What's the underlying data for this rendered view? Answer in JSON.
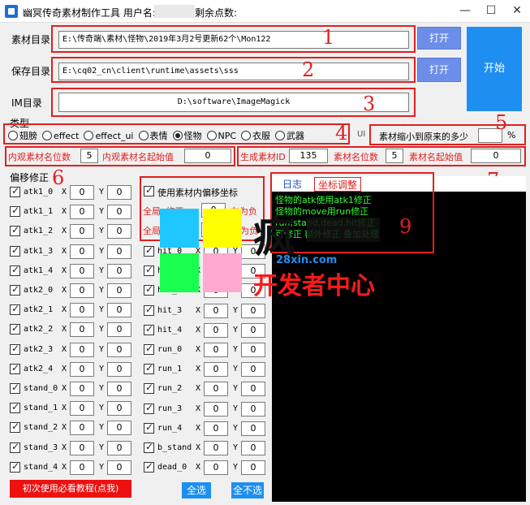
{
  "window": {
    "title": "幽冥传奇素材制作工具 用户名:",
    "title_remain": "剩余点数:",
    "minimize": "—",
    "maximize": "☐",
    "close": "✕"
  },
  "paths": {
    "material_label": "素材目录",
    "material_value": "E:\\传奇端\\素材\\怪物\\2019年3月2号更新62个\\Mon122",
    "save_label": "保存目录",
    "save_value": "E:\\cq02_cn\\client\\runtime\\assets\\sss",
    "im_label": "IM目录",
    "im_value": "D:\\software\\ImageMagick",
    "open_label": "打开",
    "open2_label": "打开",
    "start_label": "开始"
  },
  "type": {
    "label": "类型",
    "options": [
      "翅膀",
      "effect",
      "effect_ui",
      "表情",
      "怪物",
      "NPC",
      "衣服",
      "武器"
    ],
    "selected": 4
  },
  "scale": {
    "label": "素材缩小到原来的多少",
    "value": "",
    "unit": "%",
    "ui_tag": "UI"
  },
  "inner": {
    "digits_label": "内观素材名位数",
    "digits_value": "5",
    "start_label": "内观素材名起始值",
    "start_value": "0"
  },
  "gen": {
    "id_label": "生成素材ID",
    "id_value": "135",
    "digits_label": "素材名位数",
    "digits_value": "5",
    "start_label": "素材名起始值",
    "start_value": "0"
  },
  "offset": {
    "label": "偏移修正",
    "use_internal_label": "使用素材内偏移坐标",
    "x_label": "X",
    "y_label": "Y",
    "global_x_label": "全局x修正",
    "global_y_label": "全局",
    "global_x_value": "0",
    "global_y_value": "0",
    "hint_pos": "左为负",
    "hint_pos2": "为负",
    "left_rows": [
      {
        "name": "atk1_0",
        "x": "0",
        "y": "0"
      },
      {
        "name": "atk1_1",
        "x": "0",
        "y": "0"
      },
      {
        "name": "atk1_2",
        "x": "0",
        "y": "0"
      },
      {
        "name": "atk1_3",
        "x": "0",
        "y": "0"
      },
      {
        "name": "atk1_4",
        "x": "0",
        "y": "0"
      },
      {
        "name": "atk2_0",
        "x": "0",
        "y": "0"
      },
      {
        "name": "atk2_1",
        "x": "0",
        "y": "0"
      },
      {
        "name": "atk2_2",
        "x": "0",
        "y": "0"
      },
      {
        "name": "atk2_3",
        "x": "0",
        "y": "0"
      },
      {
        "name": "atk2_4",
        "x": "0",
        "y": "0"
      },
      {
        "name": "stand_0",
        "x": "0",
        "y": "0"
      },
      {
        "name": "stand_1",
        "x": "0",
        "y": "0"
      },
      {
        "name": "stand_2",
        "x": "0",
        "y": "0"
      },
      {
        "name": "stand_3",
        "x": "0",
        "y": "0"
      },
      {
        "name": "stand_4",
        "x": "0",
        "y": "0"
      }
    ],
    "right_rows": [
      {
        "name": "hit_0",
        "x": "0",
        "y": "0"
      },
      {
        "name": "hit_1",
        "x": "0",
        "y": "0"
      },
      {
        "name": "hit_2",
        "x": "0",
        "y": "0"
      },
      {
        "name": "hit_3",
        "x": "0",
        "y": "0"
      },
      {
        "name": "hit_4",
        "x": "0",
        "y": "0"
      },
      {
        "name": "run_0",
        "x": "0",
        "y": "0"
      },
      {
        "name": "run_1",
        "x": "0",
        "y": "0"
      },
      {
        "name": "run_2",
        "x": "0",
        "y": "0"
      },
      {
        "name": "run_3",
        "x": "0",
        "y": "0"
      },
      {
        "name": "run_4",
        "x": "0",
        "y": "0"
      },
      {
        "name": "b_stand",
        "x": "0",
        "y": "0"
      },
      {
        "name": "dead_0",
        "x": "0",
        "y": "0"
      }
    ]
  },
  "log": {
    "tab_log": "日志",
    "tab_adjust": "坐标调整",
    "lines": [
      "怪物的atk使用atk1修正",
      "怪物的move用run修正",
      "run,stand,dead,hit修正",
      "可修正 额外修正 叠加处理"
    ]
  },
  "buttons": {
    "tutorial": "初次使用必看教程(点我)",
    "select_all": "全选",
    "select_none": "全不选"
  },
  "annotations": [
    "1",
    "2",
    "3",
    "4",
    "5",
    "6",
    "7",
    "9"
  ],
  "watermark": {
    "line1": "疯",
    "line2": "28xin.com",
    "line3": "开发者中心"
  },
  "colors": {
    "accent": "#1e8ff0",
    "annotation": "#e02020",
    "console_text": "#30ff30",
    "swatches": [
      "#1ec8ff",
      "#ffff00",
      "#18ff50",
      "#ffa8d0"
    ]
  }
}
